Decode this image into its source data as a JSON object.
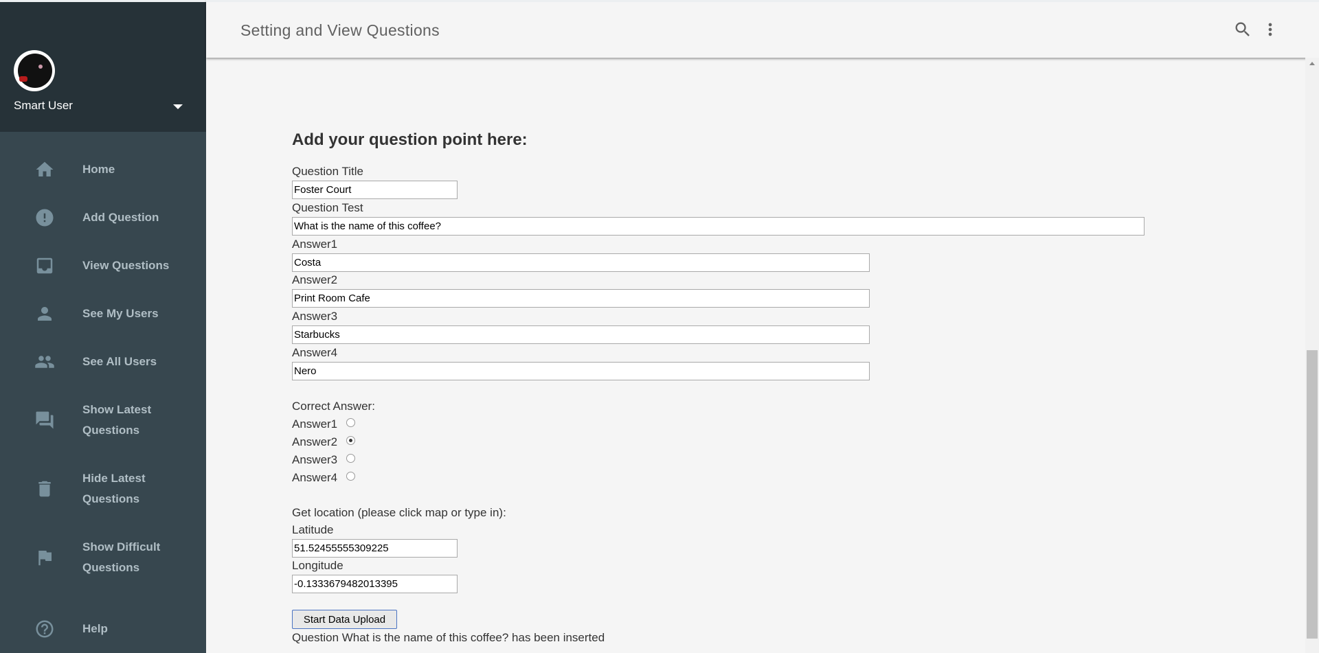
{
  "sidebar": {
    "user_name": "Smart User",
    "items": [
      {
        "label": "Home",
        "icon": "home-icon"
      },
      {
        "label": "Add Question",
        "icon": "alert-circle-icon"
      },
      {
        "label": "View Questions",
        "icon": "inbox-icon"
      },
      {
        "label": "See My Users",
        "icon": "person-icon"
      },
      {
        "label": "See All Users",
        "icon": "people-icon"
      },
      {
        "label_line1": "Show Latest",
        "label_line2": "Questions",
        "icon": "forum-icon"
      },
      {
        "label_line1": "Hide Latest",
        "label_line2": "Questions",
        "icon": "trash-icon"
      },
      {
        "label_line1": "Show Difficult",
        "label_line2": "Questions",
        "icon": "flag-icon"
      },
      {
        "label": "Help",
        "icon": "help-icon"
      }
    ]
  },
  "header": {
    "title": "Setting and View Questions"
  },
  "form": {
    "heading": "Add your question point here:",
    "question_title_label": "Question Title",
    "question_title_value": "Foster Court",
    "question_text_label": "Question Test",
    "question_text_value": "What is the name of this coffee?",
    "answer1_label": "Answer1",
    "answer1_value": "Costa",
    "answer2_label": "Answer2",
    "answer2_value": "Print Room Cafe",
    "answer3_label": "Answer3",
    "answer3_value": "Starbucks",
    "answer4_label": "Answer4",
    "answer4_value": "Nero",
    "correct_answer_label": "Correct Answer:",
    "correct_options": [
      "Answer1",
      "Answer2",
      "Answer3",
      "Answer4"
    ],
    "correct_selected": "Answer2",
    "location_label": "Get location (please click map or type in):",
    "latitude_label": "Latitude",
    "latitude_value": "51.52455555309225",
    "longitude_label": "Longitude",
    "longitude_value": "-0.1333679482013395",
    "upload_button": "Start Data Upload",
    "status_message": "Question What is the name of this coffee? has been inserted"
  },
  "colors": {
    "sidebar_bg": "#37474f",
    "sidebar_header_bg": "#263238",
    "nav_text": "#b0bec5",
    "page_bg": "#f5f5f5"
  }
}
